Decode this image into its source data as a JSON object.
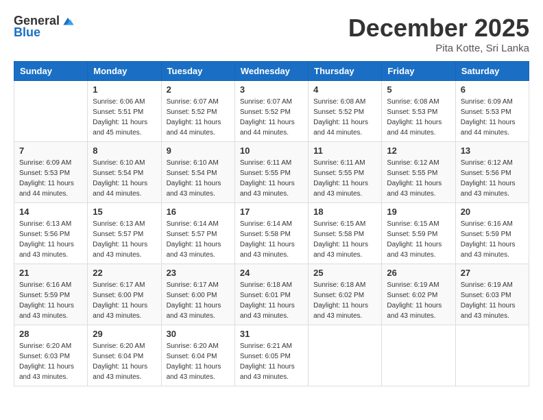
{
  "header": {
    "logo": {
      "general": "General",
      "blue": "Blue"
    },
    "title": "December 2025",
    "location": "Pita Kotte, Sri Lanka"
  },
  "weekdays": [
    "Sunday",
    "Monday",
    "Tuesday",
    "Wednesday",
    "Thursday",
    "Friday",
    "Saturday"
  ],
  "weeks": [
    [
      {
        "day": "",
        "info": ""
      },
      {
        "day": "1",
        "info": "Sunrise: 6:06 AM\nSunset: 5:51 PM\nDaylight: 11 hours and 45 minutes."
      },
      {
        "day": "2",
        "info": "Sunrise: 6:07 AM\nSunset: 5:52 PM\nDaylight: 11 hours and 44 minutes."
      },
      {
        "day": "3",
        "info": "Sunrise: 6:07 AM\nSunset: 5:52 PM\nDaylight: 11 hours and 44 minutes."
      },
      {
        "day": "4",
        "info": "Sunrise: 6:08 AM\nSunset: 5:52 PM\nDaylight: 11 hours and 44 minutes."
      },
      {
        "day": "5",
        "info": "Sunrise: 6:08 AM\nSunset: 5:53 PM\nDaylight: 11 hours and 44 minutes."
      },
      {
        "day": "6",
        "info": "Sunrise: 6:09 AM\nSunset: 5:53 PM\nDaylight: 11 hours and 44 minutes."
      }
    ],
    [
      {
        "day": "7",
        "info": "Sunrise: 6:09 AM\nSunset: 5:53 PM\nDaylight: 11 hours and 44 minutes."
      },
      {
        "day": "8",
        "info": "Sunrise: 6:10 AM\nSunset: 5:54 PM\nDaylight: 11 hours and 44 minutes."
      },
      {
        "day": "9",
        "info": "Sunrise: 6:10 AM\nSunset: 5:54 PM\nDaylight: 11 hours and 43 minutes."
      },
      {
        "day": "10",
        "info": "Sunrise: 6:11 AM\nSunset: 5:55 PM\nDaylight: 11 hours and 43 minutes."
      },
      {
        "day": "11",
        "info": "Sunrise: 6:11 AM\nSunset: 5:55 PM\nDaylight: 11 hours and 43 minutes."
      },
      {
        "day": "12",
        "info": "Sunrise: 6:12 AM\nSunset: 5:55 PM\nDaylight: 11 hours and 43 minutes."
      },
      {
        "day": "13",
        "info": "Sunrise: 6:12 AM\nSunset: 5:56 PM\nDaylight: 11 hours and 43 minutes."
      }
    ],
    [
      {
        "day": "14",
        "info": "Sunrise: 6:13 AM\nSunset: 5:56 PM\nDaylight: 11 hours and 43 minutes."
      },
      {
        "day": "15",
        "info": "Sunrise: 6:13 AM\nSunset: 5:57 PM\nDaylight: 11 hours and 43 minutes."
      },
      {
        "day": "16",
        "info": "Sunrise: 6:14 AM\nSunset: 5:57 PM\nDaylight: 11 hours and 43 minutes."
      },
      {
        "day": "17",
        "info": "Sunrise: 6:14 AM\nSunset: 5:58 PM\nDaylight: 11 hours and 43 minutes."
      },
      {
        "day": "18",
        "info": "Sunrise: 6:15 AM\nSunset: 5:58 PM\nDaylight: 11 hours and 43 minutes."
      },
      {
        "day": "19",
        "info": "Sunrise: 6:15 AM\nSunset: 5:59 PM\nDaylight: 11 hours and 43 minutes."
      },
      {
        "day": "20",
        "info": "Sunrise: 6:16 AM\nSunset: 5:59 PM\nDaylight: 11 hours and 43 minutes."
      }
    ],
    [
      {
        "day": "21",
        "info": "Sunrise: 6:16 AM\nSunset: 5:59 PM\nDaylight: 11 hours and 43 minutes."
      },
      {
        "day": "22",
        "info": "Sunrise: 6:17 AM\nSunset: 6:00 PM\nDaylight: 11 hours and 43 minutes."
      },
      {
        "day": "23",
        "info": "Sunrise: 6:17 AM\nSunset: 6:00 PM\nDaylight: 11 hours and 43 minutes."
      },
      {
        "day": "24",
        "info": "Sunrise: 6:18 AM\nSunset: 6:01 PM\nDaylight: 11 hours and 43 minutes."
      },
      {
        "day": "25",
        "info": "Sunrise: 6:18 AM\nSunset: 6:02 PM\nDaylight: 11 hours and 43 minutes."
      },
      {
        "day": "26",
        "info": "Sunrise: 6:19 AM\nSunset: 6:02 PM\nDaylight: 11 hours and 43 minutes."
      },
      {
        "day": "27",
        "info": "Sunrise: 6:19 AM\nSunset: 6:03 PM\nDaylight: 11 hours and 43 minutes."
      }
    ],
    [
      {
        "day": "28",
        "info": "Sunrise: 6:20 AM\nSunset: 6:03 PM\nDaylight: 11 hours and 43 minutes."
      },
      {
        "day": "29",
        "info": "Sunrise: 6:20 AM\nSunset: 6:04 PM\nDaylight: 11 hours and 43 minutes."
      },
      {
        "day": "30",
        "info": "Sunrise: 6:20 AM\nSunset: 6:04 PM\nDaylight: 11 hours and 43 minutes."
      },
      {
        "day": "31",
        "info": "Sunrise: 6:21 AM\nSunset: 6:05 PM\nDaylight: 11 hours and 43 minutes."
      },
      {
        "day": "",
        "info": ""
      },
      {
        "day": "",
        "info": ""
      },
      {
        "day": "",
        "info": ""
      }
    ]
  ]
}
